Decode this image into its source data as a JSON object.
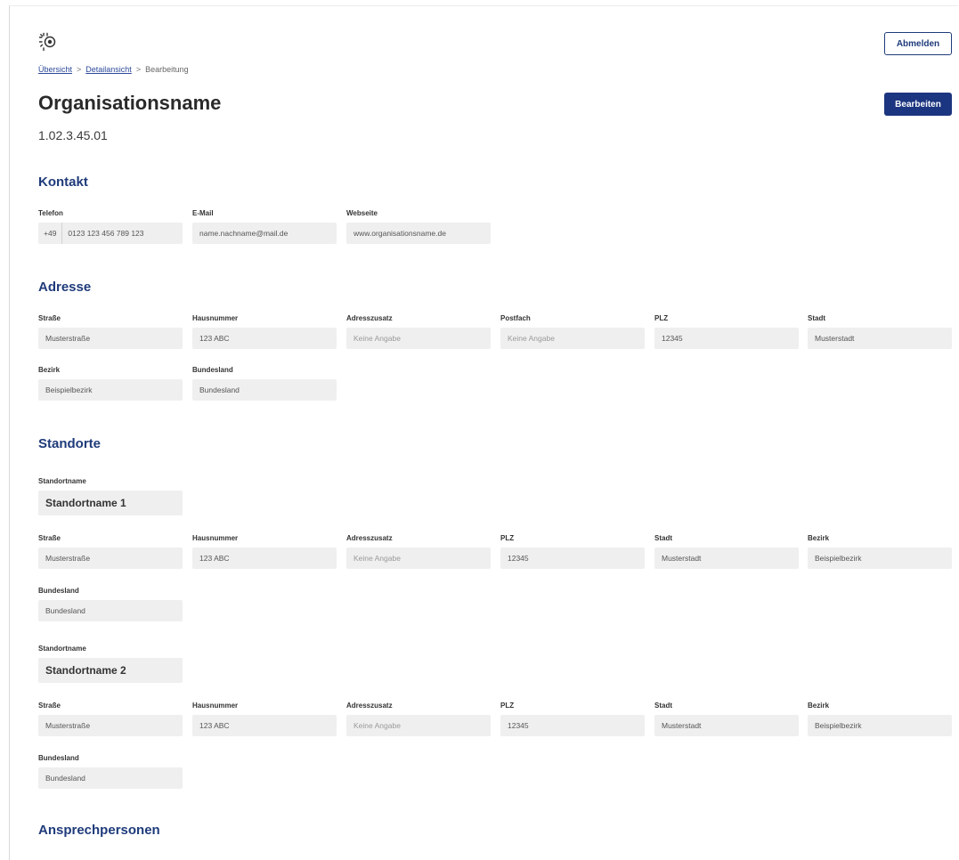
{
  "header": {
    "logout_label": "Abmelden",
    "edit_label": "Bearbeiten"
  },
  "breadcrumb": {
    "items": [
      "Übersicht",
      "Detailansicht",
      "Bearbeitung"
    ],
    "separator": ">"
  },
  "org": {
    "name": "Organisationsname",
    "id": "1.02.3.45.01"
  },
  "kontakt": {
    "title": "Kontakt",
    "telefon_label": "Telefon",
    "telefon_prefix": "+49",
    "telefon_value": "0123 123 456 789 123",
    "email_label": "E-Mail",
    "email_value": "name.nachname@mail.de",
    "website_label": "Webseite",
    "website_value": "www.organisationsname.de"
  },
  "adresse": {
    "title": "Adresse",
    "strasse_label": "Straße",
    "strasse": "Musterstraße",
    "hausnr_label": "Hausnummer",
    "hausnr": "123 ABC",
    "zusatz_label": "Adresszusatz",
    "zusatz": "Keine Angabe",
    "postfach_label": "Postfach",
    "postfach": "Keine Angabe",
    "plz_label": "PLZ",
    "plz": "12345",
    "stadt_label": "Stadt",
    "stadt": "Musterstadt",
    "bezirk_label": "Bezirk",
    "bezirk": "Beispielbezirk",
    "bundesland_label": "Bundesland",
    "bundesland": "Bundesland"
  },
  "standorte": {
    "title": "Standorte",
    "items": [
      {
        "name_label": "Standortname",
        "name": "Standortname 1",
        "strasse_label": "Straße",
        "strasse": "Musterstraße",
        "hausnr_label": "Hausnummer",
        "hausnr": "123 ABC",
        "zusatz_label": "Adresszusatz",
        "zusatz": "Keine Angabe",
        "plz_label": "PLZ",
        "plz": "12345",
        "stadt_label": "Stadt",
        "stadt": "Musterstadt",
        "bezirk_label": "Bezirk",
        "bezirk": "Beispielbezirk",
        "bundesland_label": "Bundesland",
        "bundesland": "Bundesland"
      },
      {
        "name_label": "Standortname",
        "name": "Standortname 2",
        "strasse_label": "Straße",
        "strasse": "Musterstraße",
        "hausnr_label": "Hausnummer",
        "hausnr": "123 ABC",
        "zusatz_label": "Adresszusatz",
        "zusatz": "Keine Angabe",
        "plz_label": "PLZ",
        "plz": "12345",
        "stadt_label": "Stadt",
        "stadt": "Musterstadt",
        "bezirk_label": "Bezirk",
        "bezirk": "Beispielbezirk",
        "bundesland_label": "Bundesland",
        "bundesland": "Bundesland"
      }
    ]
  },
  "ansprechpersonen": {
    "title": "Ansprechpersonen"
  },
  "colors": {
    "accent": "#1f3b7a",
    "primary_button": "#1c3580",
    "field_bg": "#efefef"
  },
  "icons": {
    "logo": "sun-logo-icon"
  }
}
